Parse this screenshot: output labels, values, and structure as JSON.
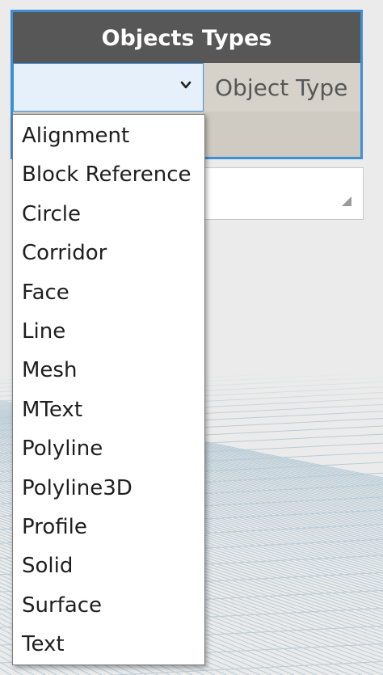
{
  "node": {
    "title": "Objects Types",
    "selected_value": "",
    "output_port_label": "Object Type"
  },
  "dropdown": {
    "options": [
      "Alignment",
      "Block Reference",
      "Circle",
      "Corridor",
      "Face",
      "Line",
      "Mesh",
      "MText",
      "Polyline",
      "Polyline3D",
      "Profile",
      "Solid",
      "Surface",
      "Text"
    ]
  },
  "icons": {
    "dropdown_toggle": "chevron-down-icon",
    "resize_grip": "resize-grip-icon"
  },
  "colors": {
    "selection_accent": "#3d8fd6",
    "node_header": "#575757",
    "node_body": "#cfcbc3",
    "canvas_background": "#ebebeb",
    "grid_lines": "#b9cbd6"
  }
}
